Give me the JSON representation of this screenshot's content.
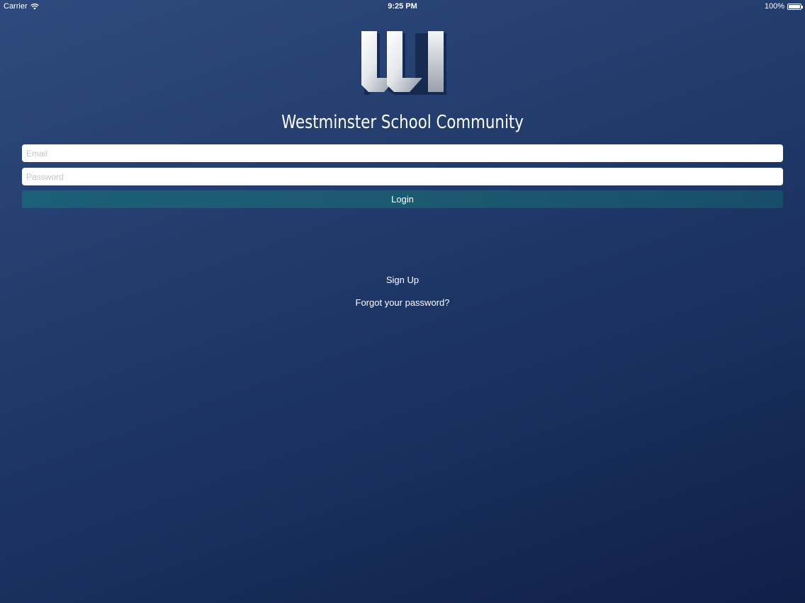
{
  "status_bar": {
    "carrier": "Carrier",
    "time": "9:25 PM",
    "battery": "100%",
    "battery_level": 1.0
  },
  "app": {
    "logo_icon": "westminster-w-logo",
    "title": "Westminster School Community"
  },
  "login_form": {
    "email_placeholder": "Email",
    "email_value": "",
    "password_placeholder": "Password",
    "password_value": "",
    "login_label": "Login"
  },
  "links": {
    "sign_up": "Sign Up",
    "forgot_password": "Forgot your password?"
  },
  "colors": {
    "background_top": "#2f4a7e",
    "background_bottom": "#0f1f48",
    "login_button": "#1b5a70",
    "field_background": "#ffffff"
  }
}
